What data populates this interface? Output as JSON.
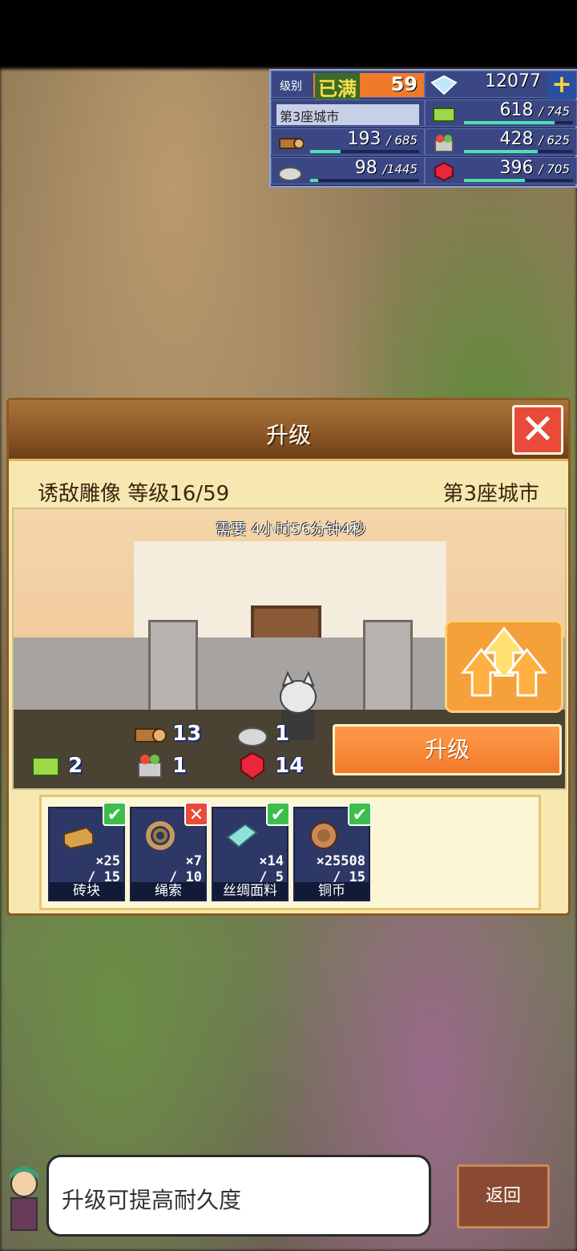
{
  "hud": {
    "level_label": "级别",
    "level_max": "已满",
    "level_value": "59",
    "gems": "12077",
    "plus": "+",
    "city": "第3座城市",
    "grass": {
      "value": "618",
      "max": "/ 745",
      "fill": 0.83
    },
    "wood": {
      "value": "193",
      "max": "/ 685",
      "fill": 0.28
    },
    "food": {
      "value": "428",
      "max": "/ 625",
      "fill": 0.68
    },
    "stone": {
      "value": "98",
      "max": "/1445",
      "fill": 0.07
    },
    "ruby": {
      "value": "396",
      "max": "/ 705",
      "fill": 0.56
    }
  },
  "dialog": {
    "title": "升级",
    "close": "✕",
    "building": "诱敌雕像 等级16/59",
    "city": "第3座城市",
    "time_text": "需要 4小时56分钟4秒",
    "upgrade_label": "升级",
    "requirements": {
      "wood": "13",
      "stone": "1",
      "grass": "2",
      "food": "1",
      "ruby": "14"
    },
    "materials": [
      {
        "name": "砖块",
        "have": "×25",
        "need": "/ 15",
        "ok": true,
        "badge": "✔"
      },
      {
        "name": "绳索",
        "have": "×7",
        "need": "/ 10",
        "ok": false,
        "badge": "✕"
      },
      {
        "name": "丝绸面料",
        "have": "×14",
        "need": "/ 5",
        "ok": true,
        "badge": "✔"
      },
      {
        "name": "铜币",
        "have": "×25508",
        "need": "/ 15",
        "ok": true,
        "badge": "✔"
      }
    ]
  },
  "bottom": {
    "hint": "升级可提高耐久度",
    "back": "返回"
  }
}
